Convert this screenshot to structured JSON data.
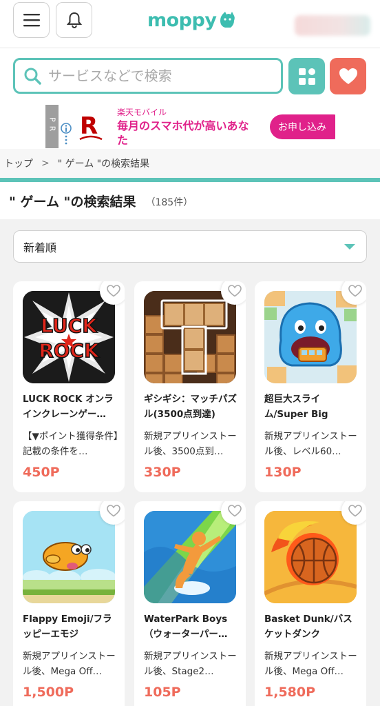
{
  "header": {
    "menu_icon": "hamburger-menu-icon",
    "bell_icon": "bell-icon",
    "logo_text": "moppy",
    "logo_icon": "moppy-mascot-icon",
    "accent_color": "#5cc3b8"
  },
  "search": {
    "placeholder": "サービスなどで検索",
    "icon": "search-icon",
    "category_icon": "grid-icon",
    "favorite_icon": "heart-icon"
  },
  "ad": {
    "pr_label": "PR",
    "brand": "楽天モバイル",
    "text": "毎月のスマホ代が高いあなた",
    "cta": "お申し込み",
    "logo_letter": "R",
    "brand_color": "#e0218a"
  },
  "breadcrumb": {
    "home": "トップ",
    "current": "\" ゲーム \"の検索結果"
  },
  "results": {
    "title": "\" ゲーム \"の検索結果",
    "count": "（185件）"
  },
  "sort": {
    "selected": "新着順"
  },
  "items": [
    {
      "title": "LUCK ROCK オンラインクレーンゲー…",
      "desc": "【▼ポイント獲得条件】記載の条件を…",
      "points": "450P",
      "thumb_text": "LUCK ROCK"
    },
    {
      "title": "ギシギシ：マッチパズル(3500点到達)",
      "desc": "新規アプリインストール後、3500点到…",
      "points": "330P"
    },
    {
      "title": "超巨大スライム/Super Big Slim…",
      "desc": "新規アプリインストール後、レベル60…",
      "points": "130P"
    },
    {
      "title": "Flappy Emoji/フラッピーエモジ(Mega…",
      "desc": "新規アプリインストール後、Mega Off…",
      "points": "1,500P"
    },
    {
      "title": "WaterPark Boys（ウォーターパー…",
      "desc": "新規アプリインストール後、Stage2…",
      "points": "105P"
    },
    {
      "title": "Basket Dunk/バスケットダンク(Mega…",
      "desc": "新規アプリインストール後、Mega Off…",
      "points": "1,580P"
    }
  ]
}
